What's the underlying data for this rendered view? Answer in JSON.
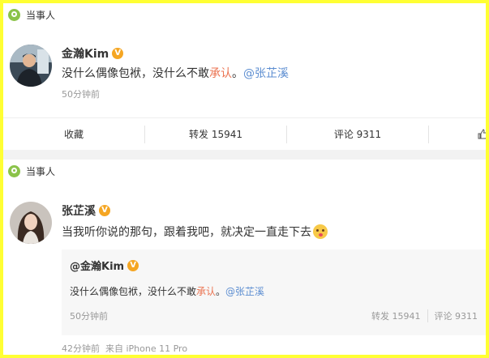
{
  "post1": {
    "tag": "当事人",
    "author": "金瀚Kim",
    "verified_badge": "V",
    "text_before": "没什么偶像包袱，没什么不敢",
    "text_highlight": "承认",
    "text_after": "。",
    "mention": "@张芷溪",
    "time": "50分钟前",
    "actions": {
      "favorite": "收藏",
      "repost": "转发 15941",
      "comment": "评论 9311"
    }
  },
  "post2": {
    "tag": "当事人",
    "author": "张芷溪",
    "verified_badge": "V",
    "text": "当我听你说的那句，跟着我吧，就决定一直走下去",
    "emoji_icon": "blush-emoji-icon",
    "quote": {
      "author": "@金瀚Kim",
      "verified_badge": "V",
      "text_before": "没什么偶像包袱，没什么不敢",
      "text_highlight": "承认",
      "text_after": "。",
      "mention": "@张芷溪",
      "time": "50分钟前",
      "repost": "转发 15941",
      "comment": "评论 9311"
    },
    "time": "42分钟前",
    "source": "来自 iPhone 11 Pro"
  },
  "colors": {
    "frame": "#ffff33",
    "tag_icon": "#8bc34a",
    "verified": "#f5a623",
    "highlight": "#eb7350",
    "mention": "#5d8ed1"
  }
}
